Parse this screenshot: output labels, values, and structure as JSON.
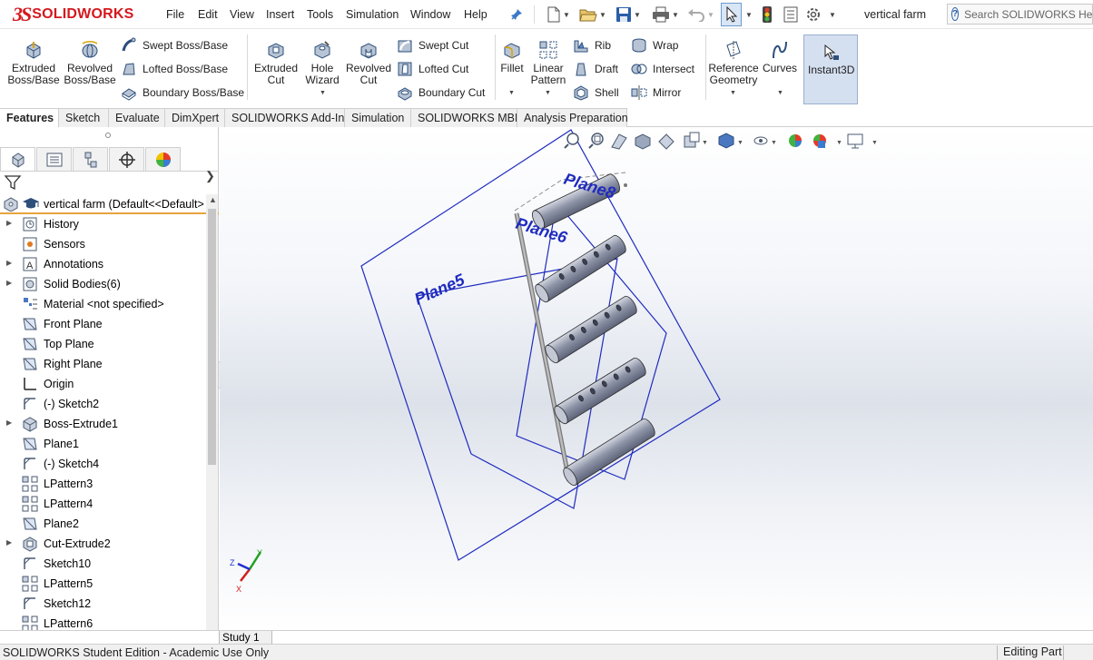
{
  "app": {
    "brand_ds": "3S",
    "brand_name": "SOLIDWORKS",
    "document_title": "vertical farm",
    "search_placeholder": "Search SOLIDWORKS Help"
  },
  "menu": [
    "File",
    "Edit",
    "View",
    "Insert",
    "Tools",
    "Simulation",
    "Window",
    "Help"
  ],
  "commands": {
    "extruded_boss": "Extruded Boss/Base",
    "revolved_boss": "Revolved Boss/Base",
    "swept_boss": "Swept Boss/Base",
    "lofted_boss": "Lofted Boss/Base",
    "boundary_boss": "Boundary Boss/Base",
    "extruded_cut": "Extruded Cut",
    "hole_wizard": "Hole Wizard",
    "revolved_cut": "Revolved Cut",
    "swept_cut": "Swept Cut",
    "lofted_cut": "Lofted Cut",
    "boundary_cut": "Boundary Cut",
    "fillet": "Fillet",
    "linear_pattern": "Linear Pattern",
    "rib": "Rib",
    "draft": "Draft",
    "shell": "Shell",
    "wrap": "Wrap",
    "intersect": "Intersect",
    "mirror": "Mirror",
    "reference_geometry": "Reference Geometry",
    "curves": "Curves",
    "instant3d": "Instant3D"
  },
  "tabs": [
    "Features",
    "Sketch",
    "Evaluate",
    "DimXpert",
    "SOLIDWORKS Add-Ins",
    "Simulation",
    "SOLIDWORKS MBD",
    "Analysis Preparation"
  ],
  "active_tab": "Features",
  "feature_tree": {
    "root": "vertical farm  (Default<<Default>",
    "items": [
      {
        "label": "History",
        "icon": "history-icon",
        "expandable": true
      },
      {
        "label": "Sensors",
        "icon": "sensors-icon",
        "expandable": false
      },
      {
        "label": "Annotations",
        "icon": "annotations-icon",
        "expandable": true
      },
      {
        "label": "Solid Bodies(6)",
        "icon": "solid-bodies-icon",
        "expandable": true
      },
      {
        "label": "Material <not specified>",
        "icon": "material-icon",
        "expandable": false
      },
      {
        "label": "Front Plane",
        "icon": "plane-icon",
        "expandable": false
      },
      {
        "label": "Top Plane",
        "icon": "plane-icon",
        "expandable": false
      },
      {
        "label": "Right Plane",
        "icon": "plane-icon",
        "expandable": false
      },
      {
        "label": "Origin",
        "icon": "origin-icon",
        "expandable": false
      },
      {
        "label": "(-) Sketch2",
        "icon": "sketch-icon",
        "expandable": false
      },
      {
        "label": "Boss-Extrude1",
        "icon": "boss-extrude-icon",
        "expandable": true
      },
      {
        "label": "Plane1",
        "icon": "plane-icon",
        "expandable": false
      },
      {
        "label": "(-) Sketch4",
        "icon": "sketch-icon",
        "expandable": false
      },
      {
        "label": "LPattern3",
        "icon": "linear-pattern-icon",
        "expandable": false
      },
      {
        "label": "LPattern4",
        "icon": "linear-pattern-icon",
        "expandable": false
      },
      {
        "label": "Plane2",
        "icon": "plane-icon",
        "expandable": false
      },
      {
        "label": "Cut-Extrude2",
        "icon": "cut-extrude-icon",
        "expandable": true
      },
      {
        "label": "Sketch10",
        "icon": "sketch-icon",
        "expandable": false
      },
      {
        "label": "LPattern5",
        "icon": "linear-pattern-icon",
        "expandable": false
      },
      {
        "label": "Sketch12",
        "icon": "sketch-icon",
        "expandable": false
      },
      {
        "label": "LPattern6",
        "icon": "linear-pattern-icon",
        "expandable": false
      }
    ]
  },
  "viewport": {
    "plane_labels": {
      "plane5": "Plane5",
      "plane6": "Plane6",
      "plane8": "Plane8"
    },
    "triad": {
      "x": "X",
      "y": "Y",
      "z": "Z"
    }
  },
  "bottom_tab": "Study 1",
  "status": {
    "left": "SOLIDWORKS Student Edition - Academic Use Only",
    "right": "Editing Part"
  },
  "colors": {
    "brand_red": "#d4181e",
    "plane_blue": "#1f2bbf",
    "active_highlight": "#d4dff0"
  }
}
